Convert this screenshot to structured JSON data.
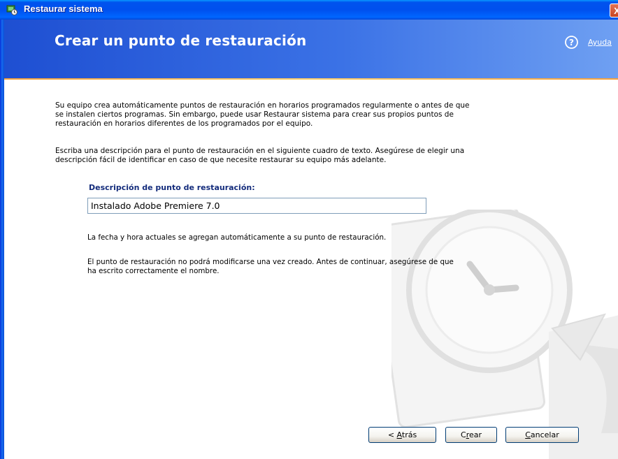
{
  "window": {
    "title": "Restaurar sistema",
    "close_glyph": "X"
  },
  "header": {
    "title": "Crear un punto de restauración",
    "help_label": "Ayuda"
  },
  "body": {
    "paragraph1_lines": [
      "Su equipo crea automáticamente puntos de restauración en horarios programados regularmente o antes de que",
      "se instalen ciertos programas. Sin embargo, puede usar Restaurar sistema para crear sus propios puntos de",
      "restauración en horarios diferentes de los programados por el equipo."
    ],
    "paragraph2_lines": [
      "Escriba una descripción para el punto de restauración en el siguiente cuadro de texto. Asegúrese de elegir una",
      "descripción fácil de identificar en caso de que necesite restaurar su equipo más adelante."
    ],
    "field_label": "Descripción de punto de restauración:",
    "field_value": "Instalado Adobe Premiere 7.0",
    "note1": "La fecha y hora actuales se agregan automáticamente a su punto de restauración.",
    "note2_lines": [
      "El punto de restauración no podrá modificarse una vez creado. Antes de continuar, asegúrese de que",
      "ha escrito correctamente el nombre."
    ]
  },
  "buttons": {
    "back_prefix": "< ",
    "back_mnemonic": "A",
    "back_rest": "trás",
    "create_prefix": "C",
    "create_mnemonic": "r",
    "create_rest": "ear",
    "cancel_mnemonic": "C",
    "cancel_rest": "ancelar"
  },
  "icons": {
    "title_icon": "system-restore-icon",
    "help_icon": "help-question-icon",
    "watermark": "clock-restore-watermark"
  },
  "colors": {
    "titlebar": "#0053ee",
    "header_band": "#3b72e6",
    "accent_line": "#f7a23c",
    "field_label": "#142c7c"
  }
}
